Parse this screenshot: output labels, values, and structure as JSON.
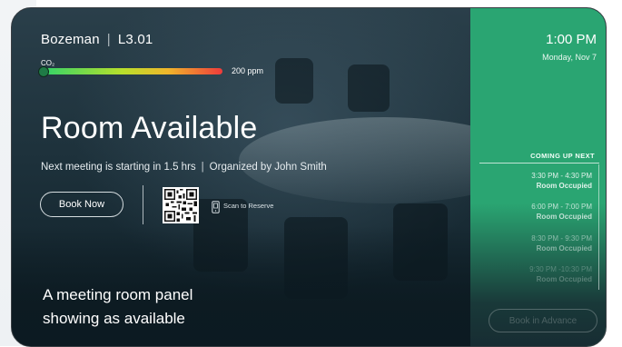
{
  "header": {
    "location": "Bozeman",
    "separator": "|",
    "room": "L3.01"
  },
  "co2": {
    "label": "CO₂",
    "value": "200 ppm",
    "level_fraction": 0.03,
    "gradient": [
      "#2fd36b",
      "#b8df2b",
      "#f0b62b",
      "#ef3b3b"
    ]
  },
  "status": {
    "title": "Room Available",
    "next_meeting": "Next meeting is starting in 1.5 hrs",
    "separator": "|",
    "organizer": "Organized by John Smith"
  },
  "actions": {
    "book_now": "Book Now",
    "scan_label": "Scan to Reserve",
    "book_advance": "Book in Advance"
  },
  "clock": {
    "time": "1:00 PM",
    "date": "Monday, Nov 7"
  },
  "upcoming": {
    "title": "COMING UP NEXT",
    "events": [
      {
        "time": "3:30 PM - 4:30 PM",
        "status": "Room Occupied",
        "opacity": 0.85
      },
      {
        "time": "6:00 PM - 7:00 PM",
        "status": "Room Occupied",
        "opacity": 0.7
      },
      {
        "time": "8:30 PM - 9:30 PM",
        "status": "Room Occupied",
        "opacity": 0.45
      },
      {
        "time": "9:30 PM -10:30 PM",
        "status": "Room Occupied",
        "opacity": 0.25
      }
    ]
  },
  "caption": {
    "line1": "A meeting room panel",
    "line2": "showing as available"
  },
  "colors": {
    "accent_green": "#2aa572",
    "panel_dark": "#16262f"
  },
  "icons": {
    "scan": "phone-icon",
    "qr": "qr-code-icon"
  }
}
